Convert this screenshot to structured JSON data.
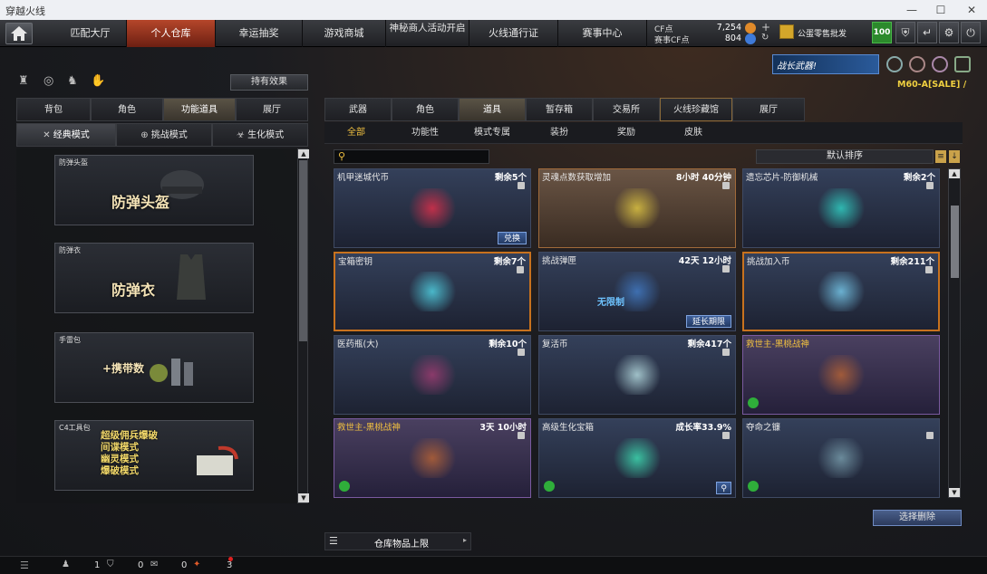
{
  "window": {
    "title": "穿越火线"
  },
  "nav": {
    "tabs": [
      {
        "label": "匹配大厅"
      },
      {
        "label": "个人仓库"
      },
      {
        "label": "幸运抽奖"
      },
      {
        "label": "游戏商城"
      },
      {
        "label": "神秘商人活动开启"
      },
      {
        "label": "火线通行证"
      },
      {
        "label": "赛事中心"
      }
    ],
    "cf_label": "CF点",
    "cf_value": "7,254",
    "match_cf_label": "赛事CF点",
    "match_cf_value": "804",
    "announce": "公蛋零售批发",
    "level": "100"
  },
  "left": {
    "effect_button": "持有效果",
    "tabs": [
      "背包",
      "角色",
      "功能道具",
      "展厅"
    ],
    "modes": [
      "经典模式",
      "挑战模式",
      "生化模式"
    ],
    "cards": [
      {
        "label": "防弹头盔",
        "title": "防弹头盔"
      },
      {
        "label": "防弹衣",
        "title": "防弹衣"
      },
      {
        "label": "手雷包",
        "title": "+携带数"
      },
      {
        "label": "C4工具包",
        "lines": [
          "超级佣兵爆破",
          "间谍模式",
          "幽灵模式",
          "爆破模式"
        ]
      }
    ]
  },
  "right": {
    "banner": "战长武器!",
    "marquee": "M60-A[SALE] /",
    "tabs": [
      "武器",
      "角色",
      "道具",
      "暂存箱",
      "交易所",
      "火线珍藏馆",
      "展厅"
    ],
    "subtabs": [
      "全部",
      "功能性",
      "模式专属",
      "装扮",
      "奖励",
      "皮肤"
    ],
    "search_placeholder": "",
    "sort_label": "默认排序",
    "items": [
      {
        "name": "机甲迷城代币",
        "right": "剩余5个",
        "action": "兑换",
        "style": "blue"
      },
      {
        "name": "灵魂点数获取增加",
        "right": "8小时 40分钟",
        "style": "warm"
      },
      {
        "name": "遗忘芯片-防御机械",
        "right": "剩余2个",
        "style": "blue"
      },
      {
        "name": "宝箱密钥",
        "right": "剩余7个",
        "style": "sel"
      },
      {
        "name": "挑战弹匣",
        "right": "42天 12小时",
        "action": "延长期限",
        "style": "blue",
        "art_text": "无限制"
      },
      {
        "name": "挑战加入币",
        "right": "剩余211个",
        "style": "sel"
      },
      {
        "name": "医药瓶(大)",
        "right": "剩余10个",
        "style": "blue"
      },
      {
        "name": "复活币",
        "right": "剩余417个",
        "style": "blue"
      },
      {
        "name": "救世主-黑桃战神",
        "right": "",
        "style": "purple",
        "name_yellow": true
      },
      {
        "name": "救世主-黑桃战神",
        "right": "3天 10小时",
        "style": "purple",
        "name_yellow": true
      },
      {
        "name": "高级生化宝箱",
        "right": "成长率33.9%",
        "style": "blue"
      },
      {
        "name": "夺命之镰",
        "right": "",
        "style": "blue"
      }
    ],
    "select_delete": "选择删除",
    "storage_limit": "仓库物品上限"
  },
  "status": {
    "counts": [
      "1",
      "0",
      "0",
      "3"
    ]
  },
  "colors": {
    "accent": "#c8721e",
    "active_tab": "#b5462a",
    "highlight": "#f0c040"
  }
}
